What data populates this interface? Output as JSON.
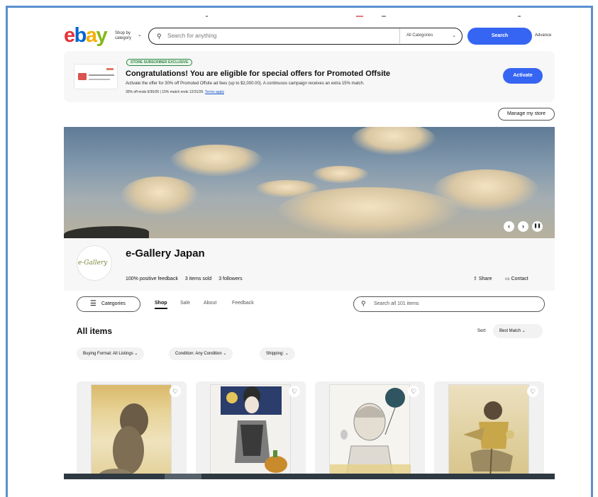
{
  "header": {
    "logo": {
      "e": "e",
      "b": "b",
      "a": "a",
      "y": "y"
    },
    "shop_by_category": [
      "Shop by",
      "category"
    ],
    "search_placeholder": "Search for anything",
    "category_select": "All Categories",
    "search_button": "Search",
    "advanced": "Advance"
  },
  "promo": {
    "badge": "STORE SUBSCRIBER EXCLUSIVE",
    "title": "Congratulations! You are eligible for special offers for Promoted Offsite",
    "description": "Activate the offer for 30% off Promoted Offsite ad fees (up to $2,000.00). A continuous campaign receives an extra 15% match.",
    "terms_text": "30% off ends 6/30/26 | 15% match ends 12/31/26.",
    "terms_link": "Terms apply",
    "activate_button": "Activate"
  },
  "manage_store": "Manage my store",
  "hero": {
    "prev": "‹",
    "next": "›",
    "pause": "❚❚"
  },
  "store": {
    "avatar_text": "e-Gallery",
    "name": "e-Gallery Japan",
    "feedback": "100% positive feedback",
    "items_sold": "3 items sold",
    "followers": "3 followers",
    "share": "Share",
    "contact": "Contact"
  },
  "nav": {
    "categories_button": "Categories",
    "tabs": [
      "Shop",
      "Sale",
      "About",
      "Feedback"
    ],
    "active_tab": "Shop",
    "store_search_placeholder": "Search all 101 items"
  },
  "listing": {
    "heading": "All items",
    "sort_label": "Sort:",
    "sort_value": "Best Match",
    "filters": [
      "Buying Format: All Listings",
      "Condition: Any Condition",
      "Shipping:"
    ]
  },
  "colors": {
    "ebay_red": "#e53238",
    "ebay_blue": "#0064d2",
    "ebay_yellow": "#f5af02",
    "ebay_green": "#86b817",
    "action_blue": "#3665f3"
  }
}
